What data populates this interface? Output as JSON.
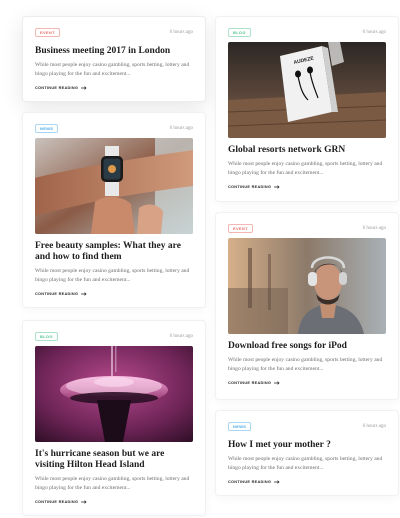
{
  "colors": {
    "badge_red": "#e8706a",
    "badge_green": "#4ec58f",
    "badge_blue": "#48a9e6",
    "title": "#1d1d1f",
    "text_muted": "#6c6c6c"
  },
  "cards": [
    {
      "badge": "EVENT",
      "time": "6 hours ago",
      "title": "Business meeting 2017 in London",
      "excerpt": "While most people enjoy casino gambling, sports betting, lottery and bingo playing for the fun and excitement...",
      "cta": "CONTINUE READING",
      "image": null
    },
    {
      "badge": "NEWS",
      "time": "6 hours ago",
      "title": "Free beauty samples: What they are and how to find them",
      "excerpt": "While most people enjoy casino gambling, sports betting, lottery and bingo playing for the fun and excitement...",
      "cta": "CONTINUE READING",
      "image": "smartwatch-on-wrist"
    },
    {
      "badge": "BLOG",
      "time": "6 hours ago",
      "title": "It's hurricane season but we are visiting Hilton Head Island",
      "excerpt": "While most people enjoy casino gambling, sports betting, lottery and bingo playing for the fun and excitement...",
      "cta": "CONTINUE READING",
      "image": "pink-observation-tower"
    },
    {
      "badge": "BLOG",
      "time": "6 hours ago",
      "title": "Global resorts network GRN",
      "excerpt": "While most people enjoy casino gambling, sports betting, lottery and bingo playing for the fun and excitement...",
      "cta": "CONTINUE READING",
      "image": "audeze-earphones-box",
      "image_text": "AUDEZE"
    },
    {
      "badge": "EVENT",
      "time": "6 hours ago",
      "title": "Download free songs for iPod",
      "excerpt": "While most people enjoy casino gambling, sports betting, lottery and bingo playing for the fun and excitement...",
      "cta": "CONTINUE READING",
      "image": "man-with-headphones"
    },
    {
      "badge": "NEWS",
      "time": "6 hours ago",
      "title": "How I met your mother ?",
      "excerpt": "While most people enjoy casino gambling, sports betting, lottery and bingo playing for the fun and excitement...",
      "cta": "CONTINUE READING",
      "image": null
    }
  ]
}
